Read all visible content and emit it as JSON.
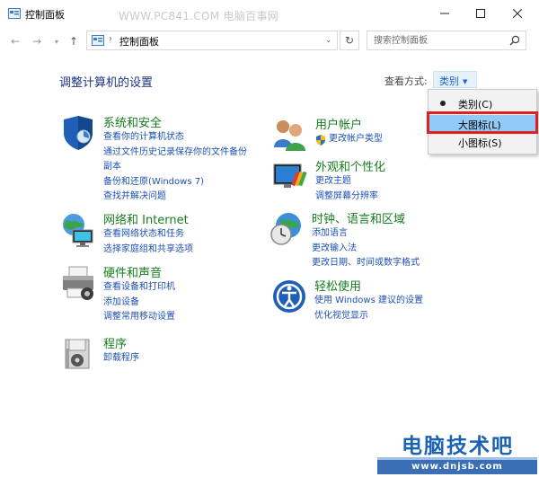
{
  "window": {
    "title": "控制面板",
    "watermark": "WWW.PC841.COM 电脑百事网",
    "minimize_glyph": "—",
    "maximize_glyph": "☐",
    "close_glyph": "✕"
  },
  "nav": {
    "back": "←",
    "forward": "→",
    "recent": "▾",
    "up": "↑",
    "address_sep": "›",
    "address_path": "控制面板",
    "address_dropdown": "⌄",
    "refresh": "↻",
    "search_placeholder": "搜索控制面板"
  },
  "main": {
    "title": "调整计算机的设置",
    "view_by_label": "查看方式:",
    "view_by_value": "类别",
    "view_by_arrow": "▼"
  },
  "view_menu": {
    "items": [
      {
        "label": "类别(C)",
        "selected": true
      },
      {
        "label": "大图标(L)",
        "highlighted": true
      },
      {
        "label": "小图标(S)"
      }
    ]
  },
  "categories": {
    "system_security": {
      "title": "系统和安全",
      "icon": "shield-icon",
      "links": [
        "查看你的计算机状态",
        "通过文件历史记录保存你的文件备份",
        "副本",
        "备份和还原(Windows 7)",
        "查找并解决问题"
      ]
    },
    "network": {
      "title": "网络和 Internet",
      "icon": "network-globe-icon",
      "links": [
        "查看网络状态和任务",
        "选择家庭组和共享选项"
      ]
    },
    "hardware": {
      "title": "硬件和声音",
      "icon": "printer-icon",
      "links": [
        "查看设备和打印机",
        "添加设备",
        "调整常用移动设置"
      ]
    },
    "programs": {
      "title": "程序",
      "icon": "programs-icon",
      "links": [
        "卸载程序"
      ]
    },
    "user_accounts": {
      "title": "用户帐户",
      "icon": "users-icon",
      "links": [
        "更改帐户类型"
      ]
    },
    "appearance": {
      "title": "外观和个性化",
      "icon": "appearance-icon",
      "links": [
        "更改主题",
        "调整屏幕分辨率"
      ]
    },
    "clock_region": {
      "title": "时钟、语言和区域",
      "icon": "clock-globe-icon",
      "links": [
        "添加语言",
        "更改输入法",
        "更改日期、时间或数字格式"
      ]
    },
    "ease_of_access": {
      "title": "轻松使用",
      "icon": "ease-of-access-icon",
      "links": [
        "使用 Windows 建议的设置",
        "优化视觉显示"
      ]
    }
  },
  "footer": {
    "brand": "电脑技术吧",
    "url": "www.dnjsb.com"
  },
  "colors": {
    "heading_green": "#167d1c",
    "link_blue": "#1e50b4",
    "title_blue": "#1e3287",
    "menu_highlight": "#91c9f7",
    "annotation_red": "#e0201f"
  }
}
